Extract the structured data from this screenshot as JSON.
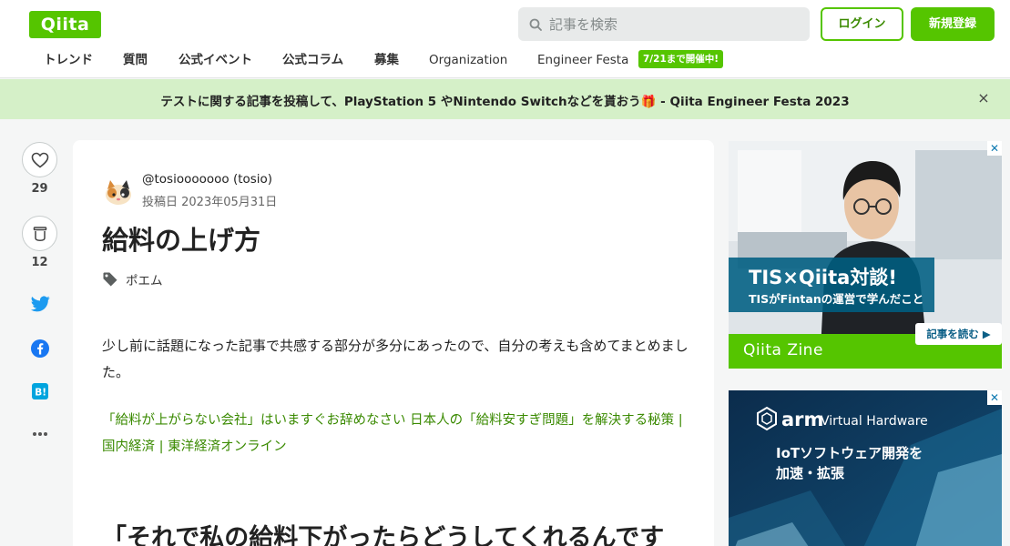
{
  "header": {
    "logo": "Qiita",
    "search_placeholder": "記事を検索",
    "login": "ログイン",
    "signup": "新規登録"
  },
  "nav": {
    "items": [
      "トレンド",
      "質問",
      "公式イベント",
      "公式コラム",
      "募集",
      "Organization",
      "Engineer Festa"
    ],
    "badge": "7/21まで開催中!"
  },
  "banner": {
    "text": "テストに関する記事を投稿して、PlayStation 5 やNintendo Switchなどを貰おう🎁 - Qiita Engineer Festa 2023",
    "close": "×"
  },
  "rail": {
    "likes": "29",
    "stocks": "12"
  },
  "article": {
    "author": "@tosiooooooo (tosio)",
    "date": "投稿日 2023年05月31日",
    "title": "給料の上げ方",
    "tag": "ポエム",
    "paragraph": "少し前に話題になった記事で共感する部分が多分にあったので、自分の考えも含めてまとめました。",
    "link": "「給料が上がらない会社」はいますぐお辞めなさい 日本人の「給料安すぎ問題」を解決する秘策 | 国内経済 | 東洋経済オンライン",
    "heading": "「それで私の給料下がったらどうしてくれるんです"
  },
  "ads": {
    "ad1": {
      "headline": "TIS×Qiita対談!",
      "sub": "TISがFintanの運営で学んだこと",
      "cta": "記事を読む ▶",
      "brand": "Qiita Zine"
    },
    "ad2": {
      "brand": "arm",
      "product": "Virtual Hardware",
      "line1": "IoTソフトウェア開発を",
      "line2": "加速・拡張"
    }
  },
  "colors": {
    "accent": "#55c500",
    "link": "#3a8a00",
    "banner_bg": "#d5f0c8"
  }
}
